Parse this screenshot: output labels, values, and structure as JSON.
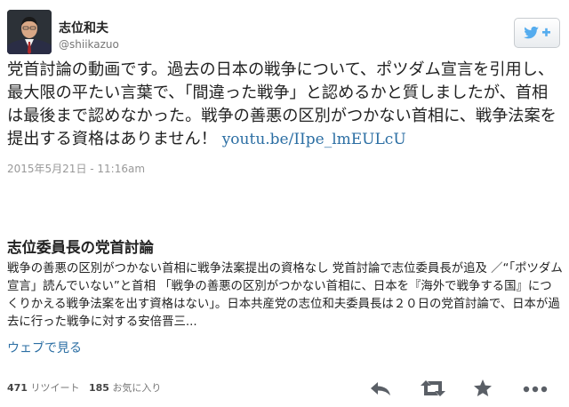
{
  "user": {
    "name": "志位和夫",
    "handle": "@shiikazuo"
  },
  "tweet": {
    "text": "党首討論の動画です。過去の日本の戦争について、ポツダム宣言を引用し、最大限の平たい言葉で、「間違った戦争」と認めるかと質しましたが、首相は最後まで認めなかった。戦争の善悪の区別がつかない首相に、戦争法案を提出する資格はありません！",
    "link": "youtu.be/IIpe_lmEULcU",
    "timestamp": "2015年5月21日 - 11:16am"
  },
  "card": {
    "title": "志位委員長の党首討論",
    "description": "戦争の善悪の区別がつかない首相に戦争法案提出の資格なし 党首討論で志位委員長が追及 ／“「ポツダム宣言」読んでいない”と首相 「戦争の善悪の区別がつかない首相に、日本を『海外で戦争する国』につくりかえる戦争法案を出す資格はない」。日本共産党の志位和夫委員長は２０日の党首討論で、日本が過去に行った戦争に対する安倍晋三...",
    "link_label": "ウェブで見る"
  },
  "stats": {
    "retweets_count": "471",
    "retweets_label": "リツイート",
    "favorites_count": "185",
    "favorites_label": "お気に入り"
  },
  "icons": {
    "follow": "twitter-bird-plus-icon",
    "reply": "reply-icon",
    "retweet": "retweet-icon",
    "favorite": "star-icon",
    "more": "more-dots-icon"
  },
  "colors": {
    "link": "#2b6ea3",
    "twitter_blue": "#55acee",
    "icon_gray": "#5a5f66"
  }
}
